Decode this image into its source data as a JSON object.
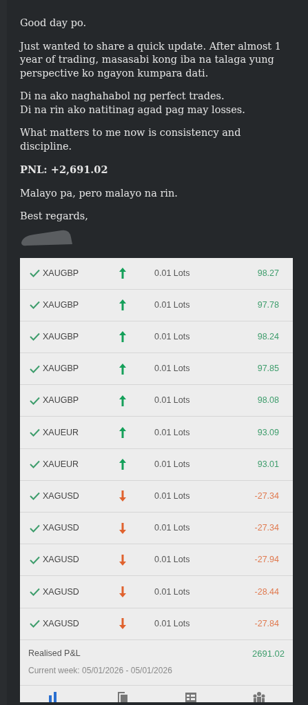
{
  "message": {
    "paragraphs": [
      {
        "lines": [
          "Good day po."
        ]
      },
      {
        "lines": [
          "Just wanted to share a quick update. After almost 1",
          "year of trading, masasabi kong iba na talaga yung",
          "perspective ko ngayon kumpara dati."
        ]
      },
      {
        "lines": [
          "Di na ako naghahabol ng perfect trades.",
          "Di na rin ako natitinag agad pag may losses."
        ]
      },
      {
        "lines": [
          "What matters to me now is consistency and",
          "discipline."
        ]
      },
      {
        "lines": [
          "**PNL: +2,691.02**"
        ]
      },
      {
        "lines": [
          "Malayo pa, pero malayo na rin."
        ]
      },
      {
        "lines": [
          "Best regards,"
        ]
      }
    ]
  },
  "trades": [
    {
      "symbol": "XAUGBP",
      "kind": "buy",
      "volume": "0.01 Lots",
      "profit": "98.27"
    },
    {
      "symbol": "XAUGBP",
      "kind": "buy",
      "volume": "0.01 Lots",
      "profit": "97.78"
    },
    {
      "symbol": "XAUGBP",
      "kind": "buy",
      "volume": "0.01 Lots",
      "profit": "98.24"
    },
    {
      "symbol": "XAUGBP",
      "kind": "buy",
      "volume": "0.01 Lots",
      "profit": "97.85"
    },
    {
      "symbol": "XAUGBP",
      "kind": "buy",
      "volume": "0.01 Lots",
      "profit": "98.08"
    },
    {
      "symbol": "XAUEUR",
      "kind": "buy",
      "volume": "0.01 Lots",
      "profit": "93.09"
    },
    {
      "symbol": "XAUEUR",
      "kind": "buy",
      "volume": "0.01 Lots",
      "profit": "93.01"
    },
    {
      "symbol": "XAGUSD",
      "kind": "sell",
      "volume": "0.01 Lots",
      "profit": "-27.34"
    },
    {
      "symbol": "XAGUSD",
      "kind": "sell",
      "volume": "0.01 Lots",
      "profit": "-27.34"
    },
    {
      "symbol": "XAGUSD",
      "kind": "sell",
      "volume": "0.01 Lots",
      "profit": "-27.94"
    },
    {
      "symbol": "XAGUSD",
      "kind": "sell",
      "volume": "0.01 Lots",
      "profit": "-28.44"
    },
    {
      "symbol": "XAGUSD",
      "kind": "sell",
      "volume": "0.01 Lots",
      "profit": "-27.84"
    }
  ],
  "summary": {
    "label": "Realised P&L",
    "value": "2691.02",
    "period": "Current week: 05/01/2026 - 05/01/2026"
  },
  "nav": [
    {
      "kind": "chart",
      "selected": true
    },
    {
      "kind": "copy",
      "selected": false
    },
    {
      "kind": "list",
      "selected": false
    },
    {
      "kind": "people",
      "selected": false
    }
  ]
}
